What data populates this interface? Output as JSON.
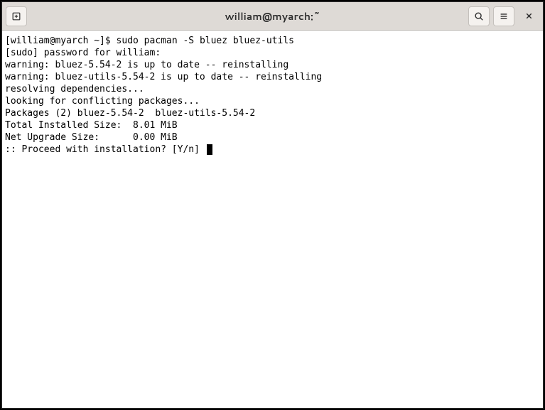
{
  "titlebar": {
    "title": "william@myarch:~"
  },
  "terminal": {
    "prompt": "[william@myarch ~]$ ",
    "command": "sudo pacman -S bluez bluez-utils",
    "lines": [
      "[sudo] password for william:",
      "warning: bluez-5.54-2 is up to date -- reinstalling",
      "warning: bluez-utils-5.54-2 is up to date -- reinstalling",
      "resolving dependencies...",
      "looking for conflicting packages...",
      "",
      "Packages (2) bluez-5.54-2  bluez-utils-5.54-2",
      "",
      "Total Installed Size:  8.01 MiB",
      "Net Upgrade Size:      0.00 MiB",
      "",
      ":: Proceed with installation? [Y/n] "
    ]
  }
}
